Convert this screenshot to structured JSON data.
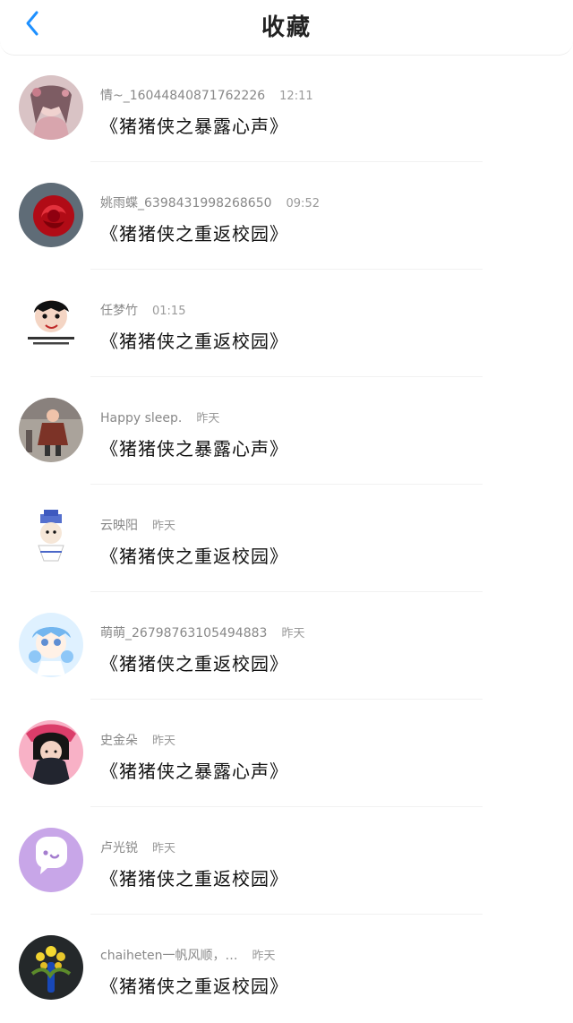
{
  "header": {
    "title": "收藏"
  },
  "items": [
    {
      "name": "情~_16044840871762226",
      "time": "12:11",
      "content": "《猪猪侠之暴露心声》"
    },
    {
      "name": "姚雨蝶_6398431998268650",
      "time": "09:52",
      "content": "《猪猪侠之重返校园》"
    },
    {
      "name": "任梦竹",
      "time": "01:15",
      "content": "《猪猪侠之重返校园》"
    },
    {
      "name": "Happy sleep.",
      "time": "昨天",
      "content": "《猪猪侠之暴露心声》"
    },
    {
      "name": "云映阳",
      "time": "昨天",
      "content": "《猪猪侠之重返校园》"
    },
    {
      "name": "萌萌_2679876310549​4883",
      "time": "昨天",
      "content": "《猪猪侠之重返校园》"
    },
    {
      "name": "史金朵",
      "time": "昨天",
      "content": "《猪猪侠之暴露心声》"
    },
    {
      "name": "卢光锐",
      "time": "昨天",
      "content": "《猪猪侠之重返校园》"
    },
    {
      "name": "chaiheten一帆风顺，…",
      "time": "昨天",
      "content": "《猪猪侠之重返校园》"
    }
  ]
}
